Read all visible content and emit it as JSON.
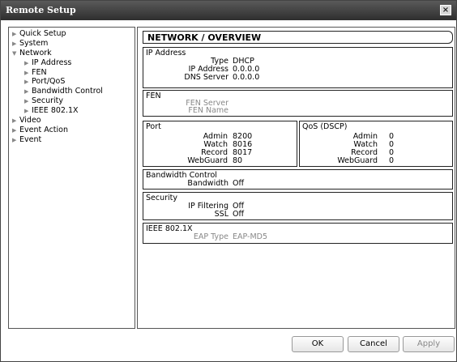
{
  "window": {
    "title": "Remote Setup",
    "close_glyph": "×"
  },
  "tree": [
    {
      "label": "Quick Setup",
      "level": 0,
      "expanded": false
    },
    {
      "label": "System",
      "level": 0,
      "expanded": false
    },
    {
      "label": "Network",
      "level": 0,
      "expanded": true
    },
    {
      "label": "IP Address",
      "level": 1,
      "expanded": false
    },
    {
      "label": "FEN",
      "level": 1,
      "expanded": false
    },
    {
      "label": "Port/QoS",
      "level": 1,
      "expanded": false
    },
    {
      "label": "Bandwidth Control",
      "level": 1,
      "expanded": false
    },
    {
      "label": "Security",
      "level": 1,
      "expanded": false
    },
    {
      "label": "IEEE 802.1X",
      "level": 1,
      "expanded": false
    },
    {
      "label": "Video",
      "level": 0,
      "expanded": false
    },
    {
      "label": "Event Action",
      "level": 0,
      "expanded": false
    },
    {
      "label": "Event",
      "level": 0,
      "expanded": false
    }
  ],
  "content": {
    "heading": "NETWORK / OVERVIEW",
    "ip_address": {
      "title": "IP Address",
      "type_label": "Type",
      "type_value": "DHCP",
      "ip_label": "IP Address",
      "ip_value": "0.0.0.0",
      "dns_label": "DNS Server",
      "dns_value": "0.0.0.0"
    },
    "fen": {
      "title": "FEN",
      "server_label": "FEN Server",
      "name_label": "FEN Name"
    },
    "port": {
      "title": "Port",
      "admin_label": "Admin",
      "admin_value": "8200",
      "watch_label": "Watch",
      "watch_value": "8016",
      "record_label": "Record",
      "record_value": "8017",
      "webguard_label": "WebGuard",
      "webguard_value": "80"
    },
    "qos": {
      "title": "QoS (DSCP)",
      "admin_label": "Admin",
      "admin_value": "0",
      "watch_label": "Watch",
      "watch_value": "0",
      "record_label": "Record",
      "record_value": "0",
      "webguard_label": "WebGuard",
      "webguard_value": "0"
    },
    "bandwidth": {
      "title": "Bandwidth Control",
      "bandwidth_label": "Bandwidth",
      "bandwidth_value": "Off"
    },
    "security": {
      "title": "Security",
      "ipfilter_label": "IP Filtering",
      "ipfilter_value": "Off",
      "ssl_label": "SSL",
      "ssl_value": "Off"
    },
    "ieee": {
      "title": "IEEE 802.1X",
      "eap_label": "EAP Type",
      "eap_value": "EAP-MD5"
    }
  },
  "buttons": {
    "ok": "OK",
    "cancel": "Cancel",
    "apply": "Apply"
  }
}
